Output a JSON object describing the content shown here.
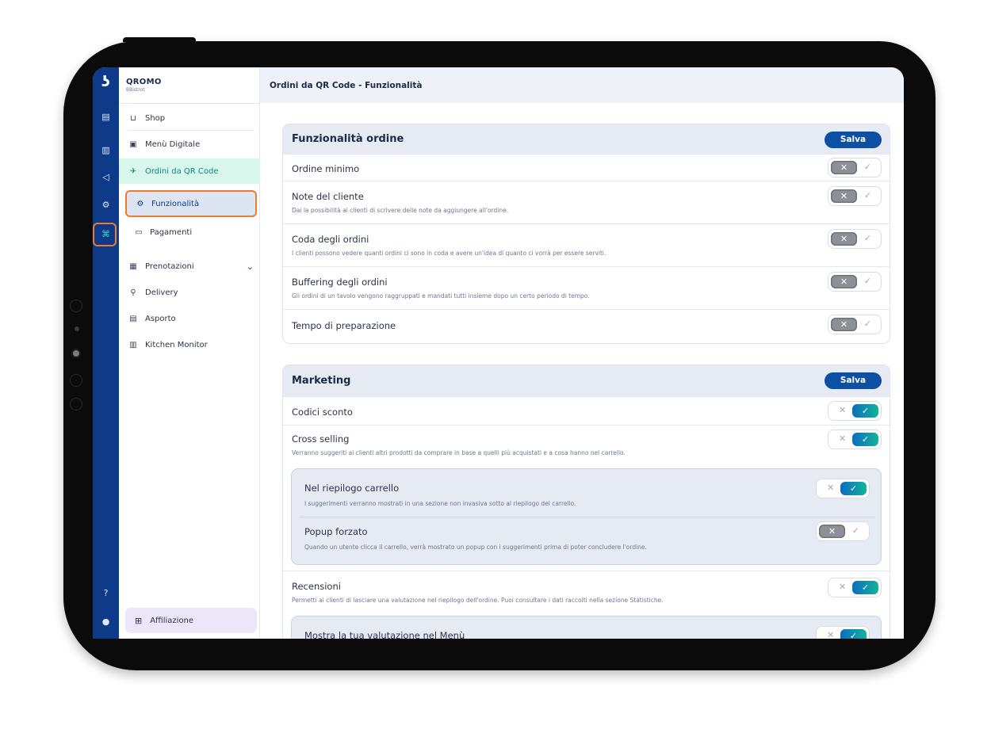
{
  "brand": {
    "name": "QROMO",
    "sub": "BBistrot"
  },
  "header": {
    "title": "Ordini da QR Code - Funzionalità"
  },
  "rail": {
    "logo": "ʖ",
    "icons": [
      "document-icon",
      "chart-icon",
      "megaphone-icon",
      "settings-icon",
      "qr-orders-icon",
      "help-icon",
      "user-icon"
    ]
  },
  "sidebar": {
    "items": [
      {
        "label": "Shop",
        "icon": "cart-icon"
      },
      {
        "label": "Menù Digitale",
        "icon": "menu-book-icon"
      },
      {
        "label": "Ordini da QR Code",
        "icon": "qr-rocket-icon"
      },
      {
        "label": "Funzionalità",
        "icon": "features-icon"
      },
      {
        "label": "Pagamenti",
        "icon": "payments-icon"
      },
      {
        "label": "Prenotazioni",
        "icon": "calendar-icon"
      },
      {
        "label": "Delivery",
        "icon": "delivery-icon"
      },
      {
        "label": "Asporto",
        "icon": "takeaway-icon"
      },
      {
        "label": "Kitchen Monitor",
        "icon": "monitor-icon"
      }
    ],
    "affiliation": {
      "label": "Affiliazione",
      "icon": "gift-icon"
    }
  },
  "order_features": {
    "title": "Funzionalità ordine",
    "save_label": "Salva",
    "rows": [
      {
        "title": "Ordine minimo",
        "desc": "",
        "enabled": false
      },
      {
        "title": "Note del cliente",
        "desc": "Dai la possibilità ai clienti di scrivere delle note da aggiungere all'ordine.",
        "enabled": false
      },
      {
        "title": "Coda degli ordini",
        "desc": "I clienti possono vedere quanti ordini ci sono in coda e avere un'idea di quanto ci vorrà per essere serviti.",
        "enabled": false
      },
      {
        "title": "Buffering degli ordini",
        "desc": "Gli ordini di un tavolo vengono raggruppati e mandati tutti insieme dopo un certo periodo di tempo.",
        "enabled": false
      },
      {
        "title": "Tempo di preparazione",
        "desc": "",
        "enabled": false
      }
    ]
  },
  "marketing": {
    "title": "Marketing",
    "save_label": "Salva",
    "rows": [
      {
        "title": "Codici sconto",
        "desc": "",
        "enabled": true
      },
      {
        "title": "Cross selling",
        "desc": "Verranno suggeriti ai clienti altri prodotti da comprare in base a quelli più acquistati e a cosa hanno nel carrello.",
        "enabled": true
      },
      {
        "title": "Recensioni",
        "desc": "Permetti ai clienti di lasciare una valutazione nel riepilogo dell'ordine. Puoi consultare i dati raccolti nella sezione Statistiche.",
        "enabled": true
      }
    ],
    "cross_selling_sub": [
      {
        "title": "Nel riepilogo carrello",
        "desc": "I suggerimenti verranno mostrati in una sezione non invasiva sotto al riepilogo del carrello.",
        "enabled": true
      },
      {
        "title": "Popup forzato",
        "desc": "Quando un utente clicca il carrello, verrà mostrato un popup con i suggerimenti prima di poter concludere l'ordine.",
        "enabled": false
      }
    ],
    "reviews_sub": [
      {
        "title": "Mostra la tua valutazione nel Menù",
        "enabled": true
      }
    ]
  },
  "toggle": {
    "off_symbol": "✕",
    "on_symbol": "✓"
  },
  "colors": {
    "rail": "#0d3b8a",
    "accent": "#0d4fa3",
    "highlight": "#ef7a2e",
    "active_bg": "#d8f6ec"
  }
}
